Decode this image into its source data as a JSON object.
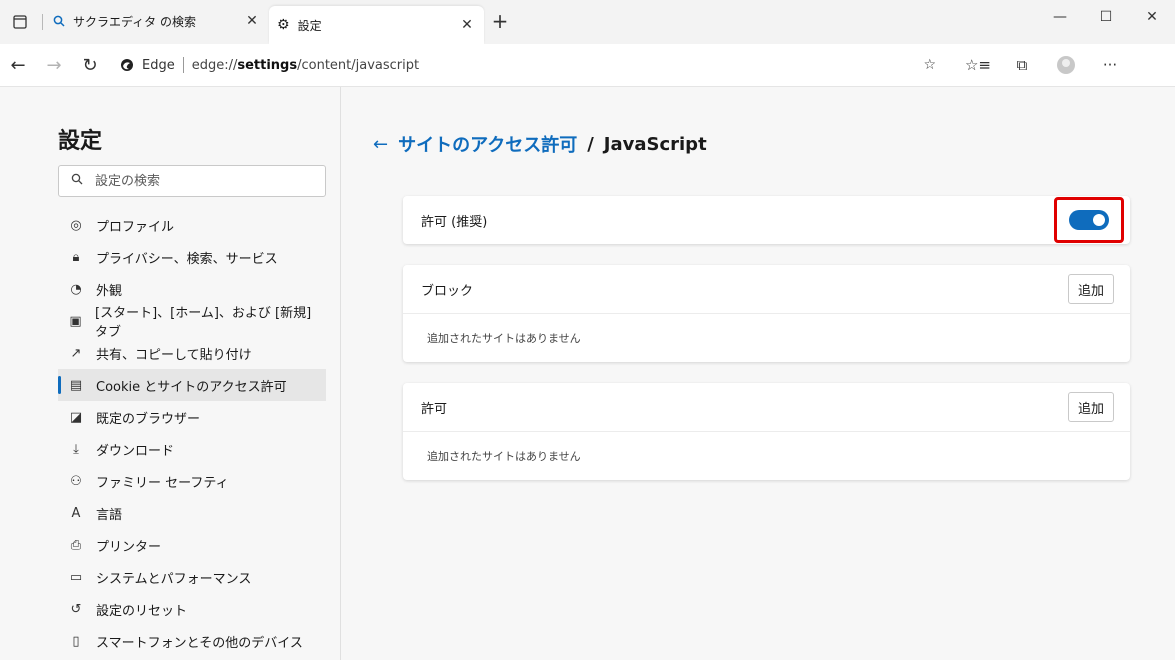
{
  "tabs": [
    {
      "title": "サクラエディタ の検索",
      "icon": "search-icon",
      "active": false
    },
    {
      "title": "設定",
      "icon": "gear-icon",
      "active": true
    }
  ],
  "address": {
    "brand": "Edge",
    "url_prefix": "edge://",
    "url_bold": "settings",
    "url_suffix": "/content/javascript"
  },
  "sidebar": {
    "title": "設定",
    "search_placeholder": "設定の検索",
    "items": [
      {
        "label": "プロファイル",
        "icon": "profile-icon"
      },
      {
        "label": "プライバシー、検索、サービス",
        "icon": "lock-icon"
      },
      {
        "label": "外観",
        "icon": "appearance-icon"
      },
      {
        "label": "[スタート]、[ホーム]、および [新規] タブ",
        "icon": "home-tab-icon"
      },
      {
        "label": "共有、コピーして貼り付け",
        "icon": "share-icon"
      },
      {
        "label": "Cookie とサイトのアクセス許可",
        "icon": "cookie-permissions-icon",
        "selected": true
      },
      {
        "label": "既定のブラウザー",
        "icon": "default-browser-icon"
      },
      {
        "label": "ダウンロード",
        "icon": "download-icon"
      },
      {
        "label": "ファミリー セーフティ",
        "icon": "family-icon"
      },
      {
        "label": "言語",
        "icon": "language-icon"
      },
      {
        "label": "プリンター",
        "icon": "printer-icon"
      },
      {
        "label": "システムとパフォーマンス",
        "icon": "laptop-icon"
      },
      {
        "label": "設定のリセット",
        "icon": "reset-icon"
      },
      {
        "label": "スマートフォンとその他のデバイス",
        "icon": "phone-icon"
      }
    ]
  },
  "main": {
    "breadcrumb_link": "サイトのアクセス許可",
    "breadcrumb_sep": "/",
    "breadcrumb_current": "JavaScript",
    "allowed_label": "許可 (推奨)",
    "allowed_on": true,
    "block_section": {
      "title": "ブロック",
      "add_label": "追加",
      "empty_text": "追加されたサイトはありません"
    },
    "allow_section": {
      "title": "許可",
      "add_label": "追加",
      "empty_text": "追加されたサイトはありません"
    }
  },
  "colors": {
    "accent": "#0f6cbd",
    "highlight_box": "#e00000"
  }
}
